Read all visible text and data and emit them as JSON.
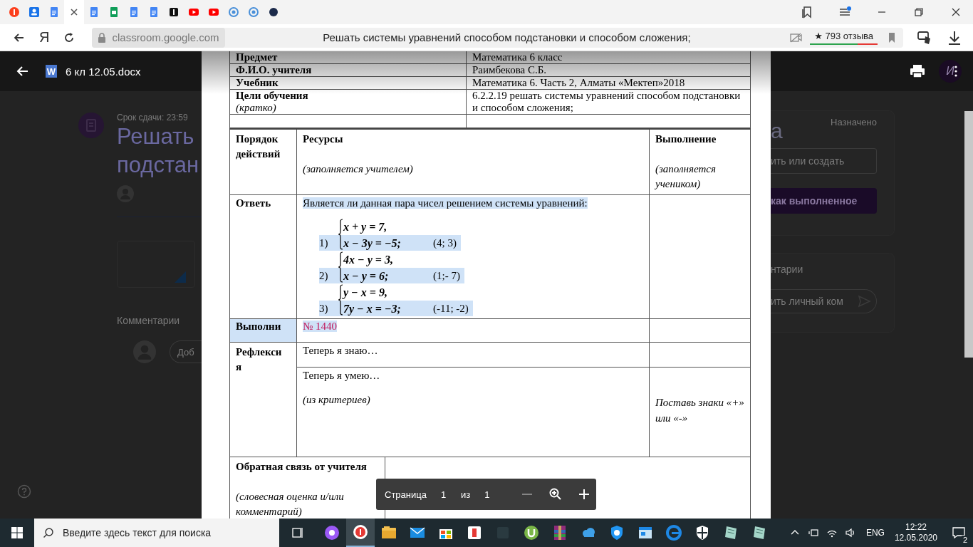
{
  "browser": {
    "tabs": [
      {
        "kind": "yandex",
        "selected": false
      },
      {
        "kind": "contacts",
        "selected": false
      },
      {
        "kind": "docs",
        "selected": false
      },
      {
        "selected": true
      },
      {
        "kind": "docs",
        "selected": false
      },
      {
        "kind": "sheets",
        "selected": false
      },
      {
        "kind": "docs",
        "selected": false
      },
      {
        "kind": "docs",
        "selected": false
      },
      {
        "kind": "black",
        "selected": false
      },
      {
        "kind": "youtube",
        "selected": false
      },
      {
        "kind": "youtube",
        "selected": false
      },
      {
        "kind": "swirl",
        "selected": false
      },
      {
        "kind": "swirl",
        "selected": false
      },
      {
        "kind": "circle",
        "selected": false
      }
    ],
    "home_button": "Я",
    "address": {
      "domain": "classroom.google.com",
      "page_title": "Решать системы уравнений способом подстановки и способом сложения;"
    },
    "reviews": "★ 793 отзыва"
  },
  "viewer": {
    "file_badge": "W",
    "file_name": "6 кл 12.05.docx",
    "avatar_letter": "И"
  },
  "backdrop": {
    "due": "Срок сдачи: 23:59",
    "title_lines": [
      "Решать",
      "подстан"
    ],
    "comments_heading": "Комментарии",
    "comment_placeholder": "Доб",
    "title_tail": "а",
    "status": "Назначено",
    "add_button": "ить или создать",
    "done_button": "как выполненное",
    "private_heading": "нтарии",
    "private_placeholder": "ить личный ком"
  },
  "document": {
    "info_rows": [
      {
        "label": "Предмет",
        "value": "Математика 6 класс"
      },
      {
        "label": "Ф.И.О. учителя",
        "value": "Раимбекова С.Б."
      },
      {
        "label": "Учебник",
        "value": "Математика 6. Часть 2, Алматы «Мектеп»2018"
      },
      {
        "label": "Цели обучения",
        "note": "(кратко)",
        "value": "6.2.2.19  решать системы уравнений способом подстановки и способом сложения;"
      }
    ],
    "columns": [
      {
        "title": "Порядок действий"
      },
      {
        "title": "Ресурсы",
        "note": "(заполняется учителем)"
      },
      {
        "title": "Выполнение",
        "note": "(заполняется учеником)"
      }
    ],
    "answer": {
      "label": "Ответь",
      "question": "Является ли данная пара чисел решением системы уравнений:",
      "highlighted": true,
      "systems": [
        {
          "number": "1)",
          "lines": [
            "x + y = 7,",
            "x − 3y = −5;"
          ],
          "pair": "(4; 3)",
          "highlighted": true
        },
        {
          "number": "2)",
          "lines": [
            "4x − y = 3,",
            "x − y = 6;"
          ],
          "pair": "(1;- 7)",
          "highlighted": true
        },
        {
          "number": "3)",
          "lines": [
            "y − x = 9,",
            "7y − x = −3;"
          ],
          "pair": "(-11; -2)",
          "highlighted": true
        }
      ]
    },
    "task": {
      "label": "Выполни",
      "text": "№ 1440",
      "highlighted": true
    },
    "reflection": {
      "label": "Рефлексия",
      "rows": [
        {
          "text": "Теперь я знаю…"
        },
        {
          "text": "Теперь я умею…",
          "note": "(из критериев)",
          "result": "Поставь знаки «+» или «-»"
        }
      ]
    },
    "feedback": {
      "label": "Обратная связь от учителя",
      "note": "(словесная оценка и/или комментарий)"
    }
  },
  "pager": {
    "label": "Страница",
    "page": "1",
    "of": "из",
    "total": "1"
  },
  "taskbar": {
    "search_placeholder": "Введите здесь текст для поиска",
    "apps": [
      {
        "kind": "alice",
        "active": false
      },
      {
        "kind": "browser",
        "active": true
      },
      {
        "kind": "folder",
        "active": false
      },
      {
        "kind": "mail",
        "active": false
      },
      {
        "kind": "store",
        "active": false
      },
      {
        "kind": "redsquare",
        "active": false
      },
      {
        "kind": "dark",
        "active": false
      },
      {
        "kind": "torrent",
        "active": false
      },
      {
        "kind": "archive",
        "active": false
      },
      {
        "kind": "cloud",
        "active": false
      },
      {
        "kind": "shield",
        "active": false
      },
      {
        "kind": "window",
        "active": false
      },
      {
        "kind": "edge",
        "active": false
      },
      {
        "kind": "security",
        "active": false
      },
      {
        "kind": "notepad",
        "active": false
      },
      {
        "kind": "notepad",
        "active": false
      }
    ],
    "language": "ENG",
    "time": "12:22",
    "date": "12.05.2020",
    "notifications": "2"
  }
}
